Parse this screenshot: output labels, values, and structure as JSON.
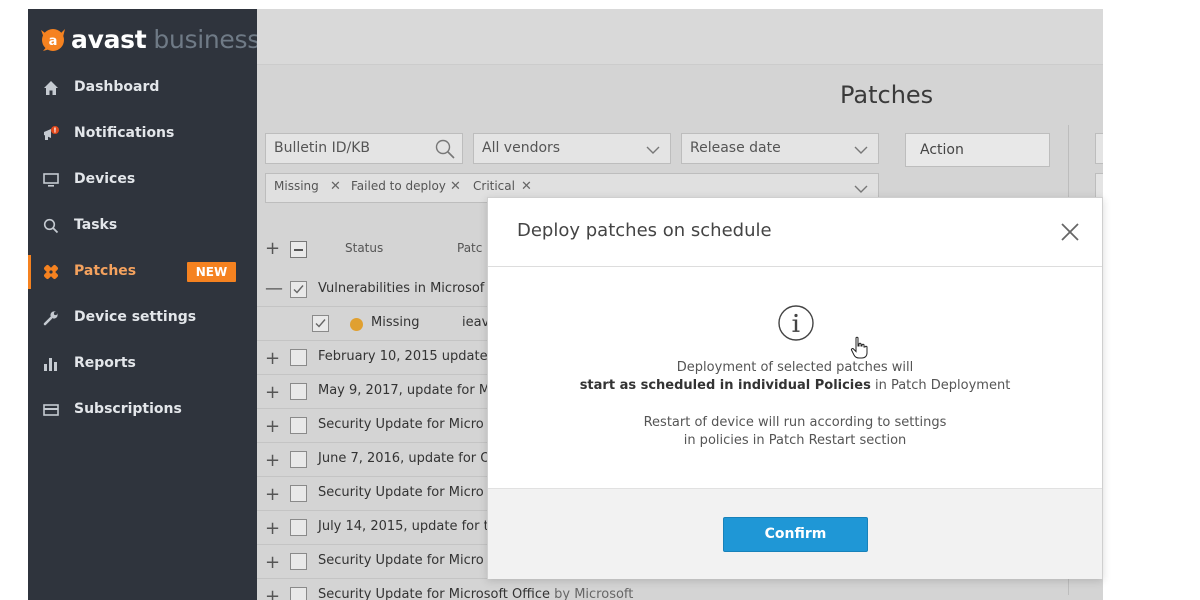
{
  "brand": {
    "name": "avast",
    "suffix": "business",
    "accent": "#f58220"
  },
  "sidebar": {
    "items": [
      {
        "label": "Dashboard",
        "icon": "home-icon"
      },
      {
        "label": "Notifications",
        "icon": "megaphone-icon"
      },
      {
        "label": "Devices",
        "icon": "monitor-icon"
      },
      {
        "label": "Tasks",
        "icon": "search-icon"
      },
      {
        "label": "Patches",
        "icon": "bandage-icon",
        "badge": "NEW",
        "active": true
      },
      {
        "label": "Device settings",
        "icon": "wrench-icon"
      },
      {
        "label": "Reports",
        "icon": "bar-chart-icon"
      },
      {
        "label": "Subscriptions",
        "icon": "card-icon"
      }
    ]
  },
  "page": {
    "title": "Patches"
  },
  "filters": {
    "search_placeholder": "Bulletin ID/KB",
    "vendor": "All vendors",
    "date": "Release date",
    "action": "Action",
    "chips": [
      "Missing",
      "Failed to deploy",
      "Critical"
    ]
  },
  "table": {
    "headers": {
      "status": "Status",
      "patch": "Patc"
    },
    "group_row": "Vulnerabilities in Microsof",
    "status_row": {
      "status": "Missing",
      "extra": "ieav"
    },
    "rows": [
      "February 10, 2015 update",
      "May 9, 2017, update for M",
      "Security Update for Micro",
      "June 7, 2016, update for O",
      "Security Update for Micro",
      "July 14, 2015, update for th",
      "Security Update for Micro",
      "Security Update for Microsoft Office"
    ],
    "last_row_suffix": "by Microsoft",
    "status_color": "#e0a030"
  },
  "modal": {
    "title": "Deploy patches on schedule",
    "line1": "Deployment of selected patches will",
    "line2_bold": "start as scheduled in individual Policies",
    "line2_rest": " in Patch Deployment",
    "line3": "Restart of device will run according to settings",
    "line4": "in policies in Patch Restart section",
    "confirm": "Confirm",
    "button_color": "#1f97d6"
  }
}
